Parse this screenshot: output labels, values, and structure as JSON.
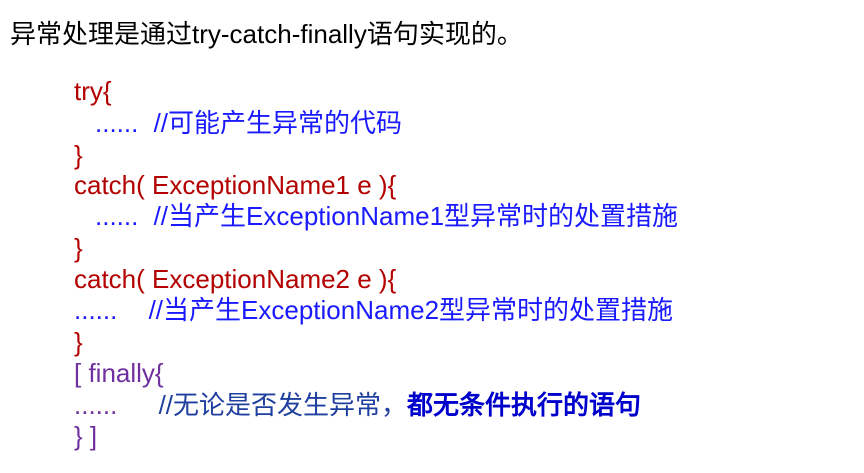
{
  "intro": {
    "prefix": "异常处理是通过",
    "keyword": "try-catch-finally",
    "suffix": "语句实现的。"
  },
  "code": {
    "try_open": "try{",
    "try_body_dots": "......",
    "try_body_comment": "//可能产生异常的代码",
    "try_close": "}",
    "catch1_open": "catch( ExceptionName1 e ){",
    "catch1_dots": "......",
    "catch1_comment_a": "//当产生",
    "catch1_comment_b": "ExceptionName1",
    "catch1_comment_c": "型异常时的处置措施",
    "catch1_close": "}",
    "catch2_open": "catch( ExceptionName2 e ){",
    "catch2_dots": "......",
    "catch2_comment_a": "//当产生",
    "catch2_comment_b": "ExceptionName2",
    "catch2_comment_c": "型异常时的处置措施",
    "catch2_close": "}",
    "finally_open": "[ finally{",
    "finally_dots": "......",
    "finally_comment_a": "//无论是否发生异常，",
    "finally_comment_b": "都无条件执行的语句",
    "finally_close": "}  ]"
  },
  "colors": {
    "keyword_red": "#b30000",
    "comment_blue": "#1a1aff",
    "finally_purple": "#7030a0",
    "bold_blue": "#0000cc"
  }
}
